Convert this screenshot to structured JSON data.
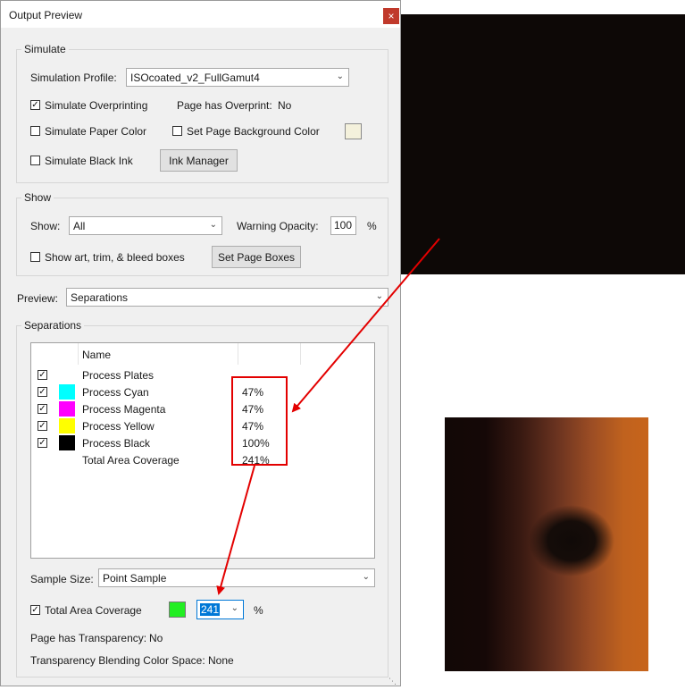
{
  "window": {
    "title": "Output Preview",
    "close_glyph": "×"
  },
  "simulate": {
    "group_label": "Simulate",
    "profile_label": "Simulation Profile:",
    "profile_value": "ISOcoated_v2_FullGamut4",
    "overprint_label": "Simulate Overprinting",
    "overprint_checked": true,
    "page_overprint_label": "Page has Overprint:",
    "page_overprint_value": "No",
    "paper_color_label": "Simulate Paper Color",
    "bg_color_label": "Set Page Background Color",
    "black_ink_label": "Simulate Black Ink",
    "ink_manager_label": "Ink Manager"
  },
  "show": {
    "group_label": "Show",
    "show_label": "Show:",
    "show_value": "All",
    "warning_opacity_label": "Warning Opacity:",
    "warning_opacity_value": "100",
    "percent": "%",
    "boxes_label": "Show art, trim, & bleed boxes",
    "set_page_boxes_label": "Set Page Boxes"
  },
  "preview": {
    "label": "Preview:",
    "value": "Separations"
  },
  "separations": {
    "group_label": "Separations",
    "column_name": "Name",
    "rows": [
      {
        "name": "Process Plates",
        "value": "",
        "checked": true,
        "color": ""
      },
      {
        "name": "Process Cyan",
        "value": "47%",
        "checked": true,
        "color": "#00ffff"
      },
      {
        "name": "Process Magenta",
        "value": "47%",
        "checked": true,
        "color": "#ff00ff"
      },
      {
        "name": "Process Yellow",
        "value": "47%",
        "checked": true,
        "color": "#ffff00"
      },
      {
        "name": "Process Black",
        "value": "100%",
        "checked": true,
        "color": "#000000"
      },
      {
        "name": "Total Area Coverage",
        "value": "241%",
        "checked": false,
        "color": ""
      }
    ]
  },
  "sample_size": {
    "label": "Sample Size:",
    "value": "Point Sample"
  },
  "tac": {
    "label": "Total Area Coverage",
    "checked": true,
    "swatch_color": "#22ee22",
    "value": "241",
    "percent": "%"
  },
  "transparency": {
    "label": "Page has Transparency:",
    "value": "No",
    "blend_label": "Transparency Blending Color Space:",
    "blend_value": "None"
  },
  "colors": {
    "annotation": "#e30000",
    "top_image": "#0d0806"
  }
}
